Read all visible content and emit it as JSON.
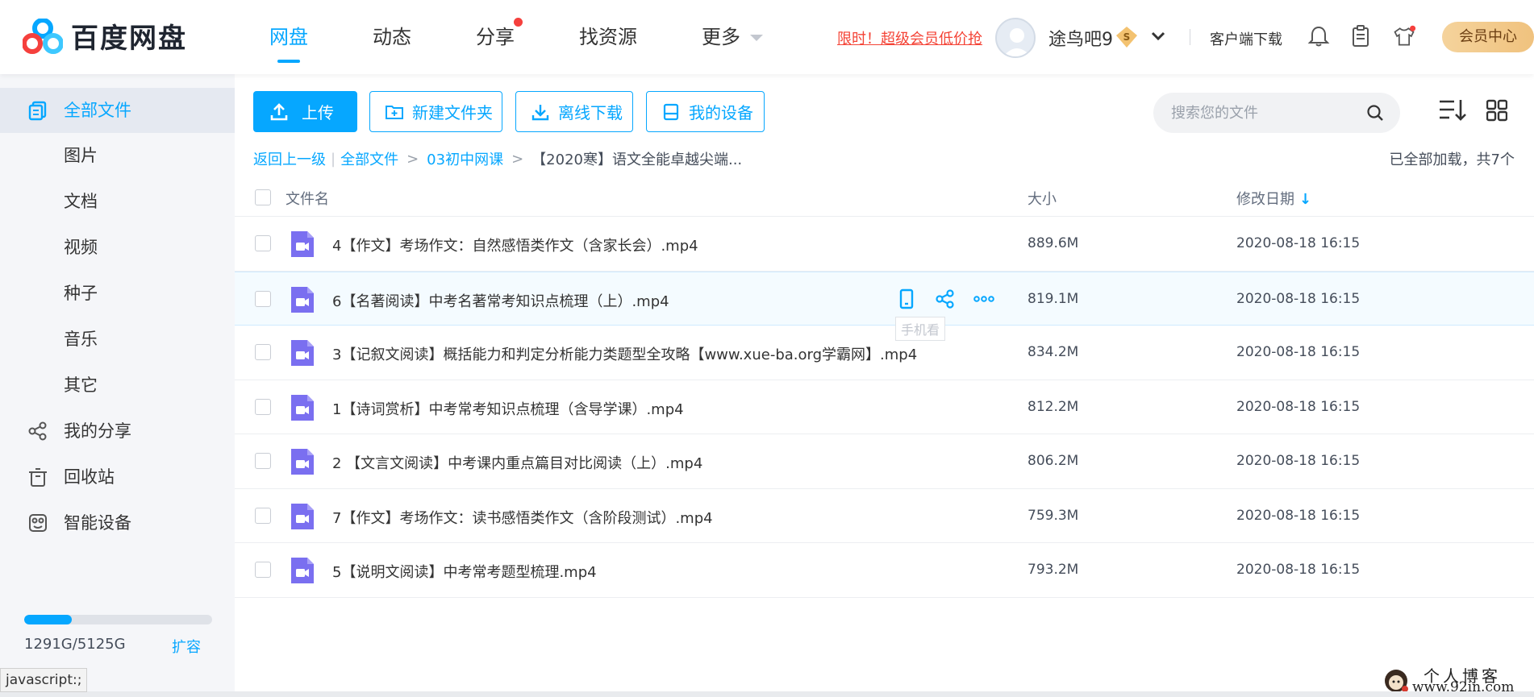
{
  "header": {
    "logo_text": "百度网盘",
    "nav": [
      {
        "label": "网盘",
        "active": true
      },
      {
        "label": "动态"
      },
      {
        "label": "分享",
        "dot": true
      },
      {
        "label": "找资源"
      },
      {
        "label": "更多",
        "caret": true
      }
    ],
    "promo": "限时！超级会员低价抢",
    "username": "途鸟吧9",
    "vip_badge": "S",
    "client_download": "客户端下载",
    "vip_center": "会员中心",
    "icons": [
      "bell-icon",
      "clipboard-icon",
      "tshirt-icon"
    ]
  },
  "sidebar": {
    "items": [
      {
        "label": "全部文件",
        "icon": "files-icon",
        "active": true
      },
      {
        "label": "图片"
      },
      {
        "label": "文档"
      },
      {
        "label": "视频"
      },
      {
        "label": "种子"
      },
      {
        "label": "音乐"
      },
      {
        "label": "其它"
      },
      {
        "label": "我的分享",
        "icon": "share-icon"
      },
      {
        "label": "回收站",
        "icon": "trash-icon"
      },
      {
        "label": "智能设备",
        "icon": "device-icon"
      }
    ],
    "storage": {
      "text": "1291G/5125G",
      "used_fraction": 0.252,
      "expand_label": "扩容"
    },
    "status_tip": "javascript:;"
  },
  "toolbar": {
    "upload": "上传",
    "new_folder": "新建文件夹",
    "offline_download": "离线下载",
    "my_devices": "我的设备",
    "search_placeholder": "搜索您的文件"
  },
  "breadcrumb": {
    "back": "返回上一级",
    "items": [
      "全部文件",
      "03初中网课"
    ],
    "current": "【2020寒】语文全能卓越尖端...",
    "loaded_text": "已全部加载，共7个"
  },
  "table": {
    "columns": {
      "name": "文件名",
      "size": "大小",
      "date": "修改日期"
    },
    "rows": [
      {
        "name": "4【作文】考场作文：自然感悟类作文（含家长会）.mp4",
        "size": "889.6M",
        "date": "2020-08-18 16:15"
      },
      {
        "name": "6【名著阅读】中考名著常考知识点梳理（上）.mp4",
        "size": "819.1M",
        "date": "2020-08-18 16:15",
        "hover": true
      },
      {
        "name": "3【记叙文阅读】概括能力和判定分析能力类题型全攻略【www.xue-ba.org学霸网】.mp4",
        "size": "834.2M",
        "date": "2020-08-18 16:15"
      },
      {
        "name": "1【诗词赏析】中考常考知识点梳理（含导学课）.mp4",
        "size": "812.2M",
        "date": "2020-08-18 16:15"
      },
      {
        "name": "2 【文言文阅读】中考课内重点篇目对比阅读（上）.mp4",
        "size": "806.2M",
        "date": "2020-08-18 16:15"
      },
      {
        "name": "7【作文】考场作文：读书感悟类作文（含阶段测试）.mp4",
        "size": "759.3M",
        "date": "2020-08-18 16:15"
      },
      {
        "name": "5【说明文阅读】中考常考题型梳理.mp4",
        "size": "793.2M",
        "date": "2020-08-18 16:15"
      }
    ],
    "hover_tooltip": "手机看"
  },
  "watermark": {
    "line1": "个人博客",
    "line2": "www.92in.com"
  },
  "colors": {
    "accent": "#06a7ff",
    "promo": "#f44336",
    "file_icon": "#7a6ff0",
    "vip_gold": "#f0c27e"
  }
}
